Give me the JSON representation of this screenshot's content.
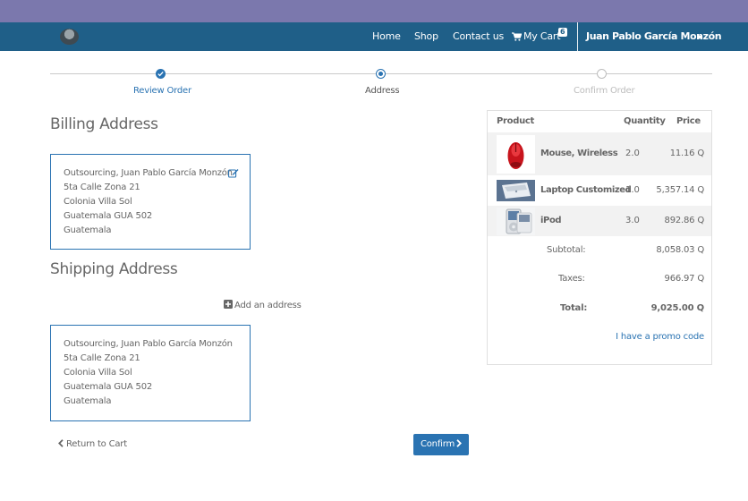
{
  "nav": {
    "home": "Home",
    "shop": "Shop",
    "contact": "Contact us",
    "cart_label": "My Cart",
    "cart_count": "6",
    "user_name": "Juan Pablo García Monzón"
  },
  "wizard": {
    "steps": [
      {
        "label": "Review Order",
        "state": "done"
      },
      {
        "label": "Address",
        "state": "current"
      },
      {
        "label": "Confirm Order",
        "state": "pending"
      }
    ]
  },
  "billing": {
    "title": "Billing Address",
    "lines": [
      "Outsourcing, Juan Pablo García Monzón",
      "5ta Calle Zona 21",
      "Colonia Villa Sol",
      "Guatemala GUA 502",
      "Guatemala"
    ]
  },
  "shipping": {
    "title": "Shipping Address",
    "add_label": "Add an address",
    "lines": [
      "Outsourcing, Juan Pablo García Monzón",
      "5ta Calle Zona 21",
      "Colonia Villa Sol",
      "Guatemala GUA 502",
      "Guatemala"
    ]
  },
  "actions": {
    "return_label": "Return to Cart",
    "confirm_label": "Confirm"
  },
  "summary": {
    "headers": {
      "product": "Product",
      "quantity": "Quantity",
      "price": "Price"
    },
    "items": [
      {
        "name": "Mouse, Wireless",
        "qty": "2.0",
        "price": "11.16 Q"
      },
      {
        "name": "Laptop Customized",
        "qty": "1.0",
        "price": "5,357.14 Q"
      },
      {
        "name": "iPod",
        "qty": "3.0",
        "price": "892.86 Q"
      }
    ],
    "subtotal_label": "Subtotal:",
    "subtotal": "8,058.03 Q",
    "taxes_label": "Taxes:",
    "taxes": "966.97 Q",
    "total_label": "Total:",
    "total": "9,025.00 Q",
    "promo_label": "I have a promo code"
  },
  "colors": {
    "topbar": "#7b78ad",
    "navbar": "#1f5f88",
    "accent": "#2a73b2"
  }
}
